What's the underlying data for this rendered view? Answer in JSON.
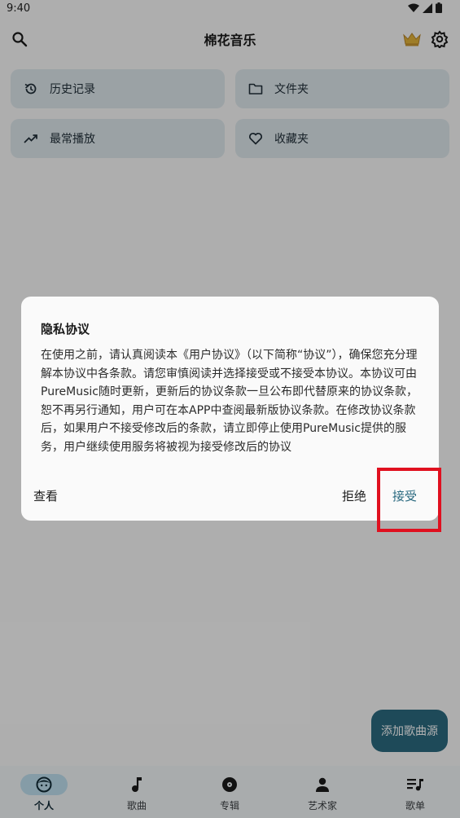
{
  "status": {
    "time": "9:40"
  },
  "app": {
    "title": "棉花音乐"
  },
  "quick": [
    {
      "label": "历史记录",
      "icon": "history-icon"
    },
    {
      "label": "文件夹",
      "icon": "folder-icon"
    },
    {
      "label": "最常播放",
      "icon": "trending-up-icon"
    },
    {
      "label": "收藏夹",
      "icon": "heart-icon"
    }
  ],
  "fab": {
    "label": "添加歌曲源"
  },
  "nav": [
    {
      "label": "个人",
      "icon": "person-face-icon",
      "active": true
    },
    {
      "label": "歌曲",
      "icon": "music-note-icon",
      "active": false
    },
    {
      "label": "专辑",
      "icon": "disc-icon",
      "active": false
    },
    {
      "label": "艺术家",
      "icon": "artist-icon",
      "active": false
    },
    {
      "label": "歌单",
      "icon": "playlist-icon",
      "active": false
    }
  ],
  "dialog": {
    "title": "隐私协议",
    "body": "在使用之前，请认真阅读本《用户协议》（以下简称“协议”），确保您充分理解本协议中各条款。请您审慎阅读并选择接受或不接受本协议。本协议可由PureMusic随时更新，更新后的协议条款一旦公布即代替原来的协议条款，恕不再另行通知，用户可在本APP中查阅最新版协议条款。在修改协议条款后，如果用户不接受修改后的条款，请立即停止使用PureMusic提供的服务，用户继续使用服务将被视为接受修改后的协议",
    "view_label": "查看",
    "reject_label": "拒绝",
    "accept_label": "接受"
  },
  "colors": {
    "accent": "#2b6a80",
    "highlight": "#e0101f",
    "card": "#dfe8ed"
  }
}
